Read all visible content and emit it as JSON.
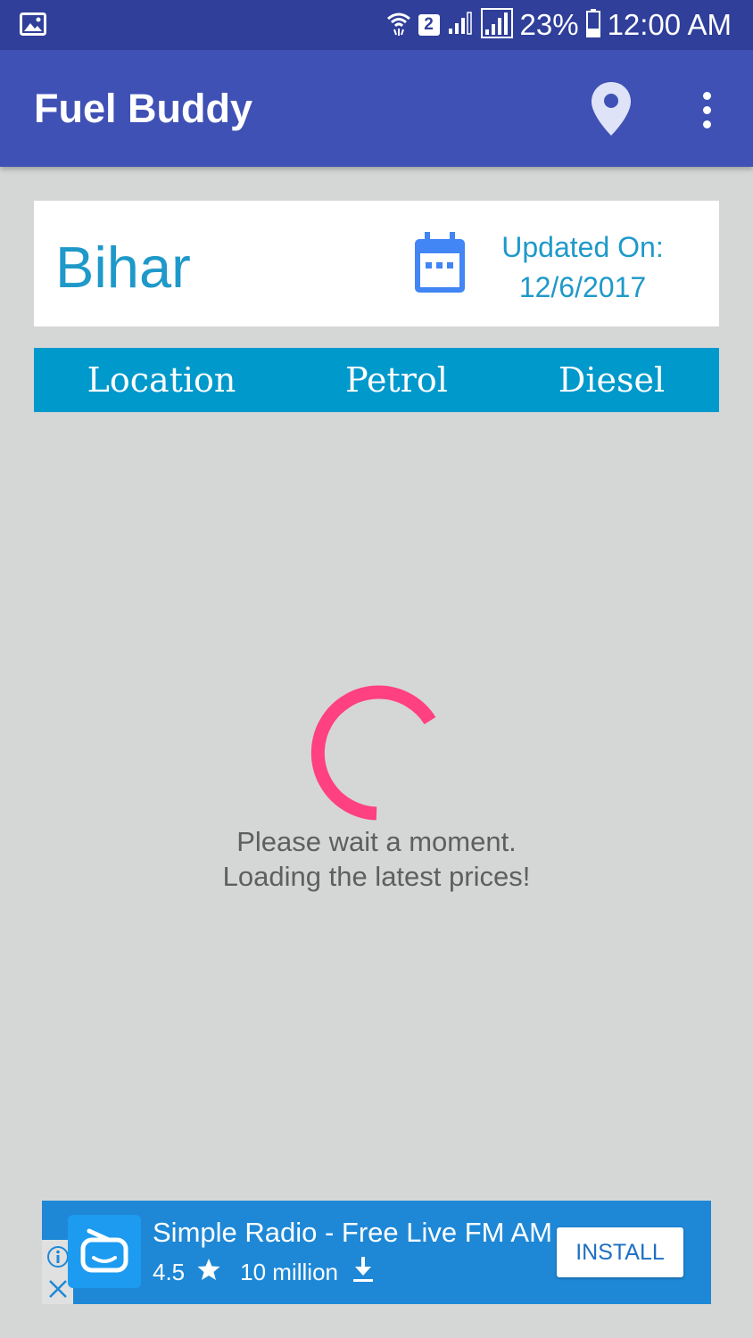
{
  "status_bar": {
    "sim_badge": "2",
    "battery": "23%",
    "time": "12:00 AM"
  },
  "app_bar": {
    "title": "Fuel Buddy"
  },
  "state_card": {
    "state": "Bihar",
    "updated_label": "Updated On:",
    "updated_date": "12/6/2017"
  },
  "table_header": {
    "columns": [
      "Location",
      "Petrol",
      "Diesel"
    ]
  },
  "loading": {
    "line1": "Please wait a moment.",
    "line2": "Loading the latest prices!"
  },
  "ad": {
    "title": "Simple Radio - Free Live FM AM",
    "rating": "4.5",
    "downloads": "10 million",
    "install_label": "INSTALL"
  },
  "colors": {
    "status_bar": "#2f3f9a",
    "app_bar": "#3f51b5",
    "accent_blue": "#1e99c9",
    "header_row": "#0099cc",
    "spinner": "#ff4081",
    "ad_background": "#1e88d6"
  },
  "icons": [
    "gallery-icon",
    "wifi-icon",
    "signal-icon",
    "battery-icon",
    "location-pin-icon",
    "more-vert-icon",
    "calendar-icon",
    "radio-app-icon",
    "star-icon",
    "download-icon",
    "info-icon",
    "close-icon"
  ]
}
